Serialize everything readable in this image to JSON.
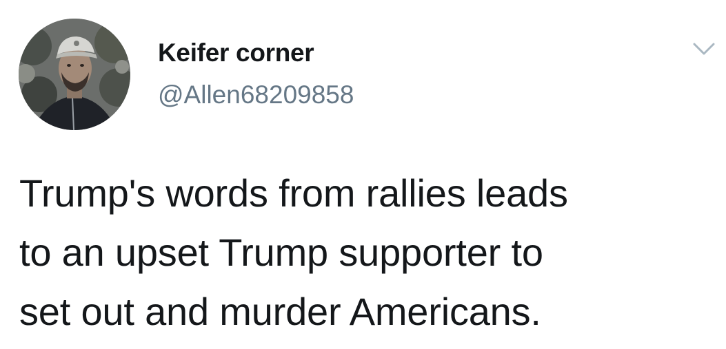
{
  "tweet": {
    "author": {
      "display_name": "Keifer corner",
      "handle": "@Allen68209858",
      "avatar_icon": "user-avatar-photo"
    },
    "menu_icon": "chevron-down-icon",
    "text_lines": [
      "Trump's words from rallies leads",
      "to an upset Trump supporter to",
      "set out and murder Americans."
    ]
  },
  "colors": {
    "background": "#ffffff",
    "name_text": "#14171a",
    "handle_text": "#657786",
    "chevron": "#aab8c2"
  }
}
